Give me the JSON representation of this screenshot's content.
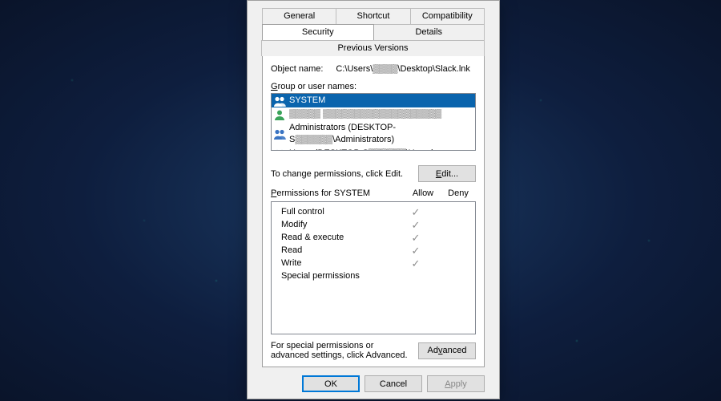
{
  "tabs": {
    "row1": [
      "General",
      "Shortcut",
      "Compatibility"
    ],
    "row2": [
      "Security",
      "Details",
      "Previous Versions"
    ],
    "active": "Security"
  },
  "object": {
    "label": "Object name:",
    "value": "C:\\Users\\▒▒▒▒\\Desktop\\Slack.lnk"
  },
  "groupList": {
    "label": "Group or user names:",
    "items": [
      {
        "icon": "group",
        "text": "SYSTEM",
        "selected": true
      },
      {
        "icon": "user",
        "text": "▒▒▒▒▒ ▒▒▒▒▒▒▒▒▒▒▒▒▒▒▒▒▒▒▒"
      },
      {
        "icon": "group",
        "text": "Administrators (DESKTOP-S▒▒▒▒▒▒\\Administrators)"
      },
      {
        "icon": "group",
        "text": "Users (DESKTOP-S▒▒▒▒▒▒\\Users)"
      }
    ]
  },
  "editHint": "To change permissions, click Edit.",
  "editButton": "Edit...",
  "perms": {
    "header": {
      "label": "Permissions for SYSTEM",
      "allow": "Allow",
      "deny": "Deny"
    },
    "rows": [
      {
        "name": "Full control",
        "allow": true,
        "deny": false
      },
      {
        "name": "Modify",
        "allow": true,
        "deny": false
      },
      {
        "name": "Read & execute",
        "allow": true,
        "deny": false
      },
      {
        "name": "Read",
        "allow": true,
        "deny": false
      },
      {
        "name": "Write",
        "allow": true,
        "deny": false
      },
      {
        "name": "Special permissions",
        "allow": false,
        "deny": false
      }
    ]
  },
  "advanced": {
    "hint": "For special permissions or advanced settings, click Advanced.",
    "button": "Advanced"
  },
  "footer": {
    "ok": "OK",
    "cancel": "Cancel",
    "apply": "Apply"
  }
}
